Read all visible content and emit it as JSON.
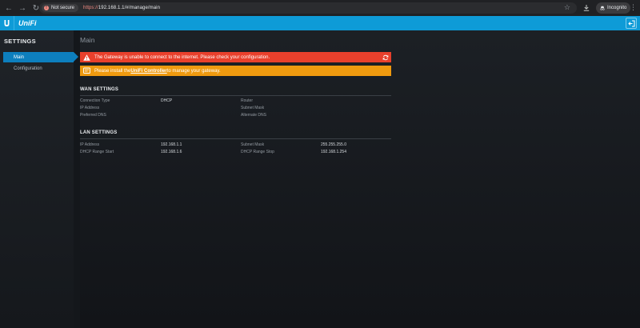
{
  "browser": {
    "security_chip": "Not secure",
    "url_scheme": "https://",
    "url_rest": "192.168.1.1/#/manage/main",
    "profile": "Incognito"
  },
  "app": {
    "brand": "UniFi",
    "accent": "#0e9bd7"
  },
  "sidebar": {
    "title": "SETTINGS",
    "items": [
      {
        "label": "Main",
        "active": true
      },
      {
        "label": "Configuration",
        "active": false
      }
    ]
  },
  "main": {
    "title": "Main",
    "alerts": {
      "error": "The Gateway is unable to connect to the internet. Please check your configuration.",
      "warning_prefix": "Please install the ",
      "warning_link": "UniFi Controller",
      "warning_suffix": " to manage your gateway."
    },
    "wan": {
      "title": "WAN SETTINGS",
      "rows": [
        {
          "label1": "Connection Type",
          "value1": "DHCP",
          "label2": "Router",
          "value2": ""
        },
        {
          "label1": "IP Address",
          "value1": "",
          "label2": "Subnet Mask",
          "value2": ""
        },
        {
          "label1": "Preferred DNS",
          "value1": "",
          "label2": "Alternate DNS",
          "value2": ""
        }
      ]
    },
    "lan": {
      "title": "LAN SETTINGS",
      "rows": [
        {
          "label1": "IP Address",
          "value1": "192.168.1.1",
          "label2": "Subnet Mask",
          "value2": "255.255.255.0"
        },
        {
          "label1": "DHCP Range Start",
          "value1": "192.168.1.6",
          "label2": "DHCP Range Stop",
          "value2": "192.168.1.254"
        }
      ]
    }
  }
}
